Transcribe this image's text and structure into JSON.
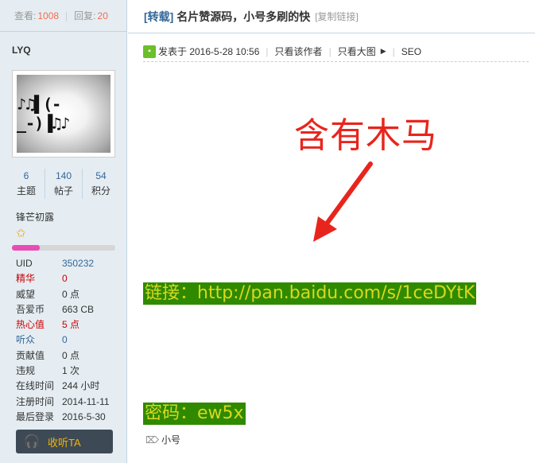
{
  "stats": {
    "views_label": "查看:",
    "views": "1008",
    "replies_label": "回复:",
    "replies": "20"
  },
  "author": {
    "name": "LYQ",
    "avatar_text": "♪♫▌(-_-)▐♫♪",
    "counts": [
      {
        "value": "6",
        "label": "主题"
      },
      {
        "value": "140",
        "label": "帖子"
      },
      {
        "value": "54",
        "label": "积分"
      }
    ],
    "group": "锋芒初露",
    "rank_progress": 0.27,
    "info": [
      {
        "key": "UID",
        "value": "350232",
        "key_color": "#333333",
        "value_color": "#336699"
      },
      {
        "key": "精华",
        "value": "0",
        "key_color": "#cc0000",
        "value_color": "#cc0000"
      },
      {
        "key": "威望",
        "value": "0 点",
        "key_color": "#333333",
        "value_color": "#333333"
      },
      {
        "key": "吾爱币",
        "value": "663 CB",
        "key_color": "#333333",
        "value_color": "#333333"
      },
      {
        "key": "热心值",
        "value": "5 点",
        "key_color": "#cc0000",
        "value_color": "#cc0000"
      },
      {
        "key": "听众",
        "value": "0",
        "key_color": "#336699",
        "value_color": "#336699"
      },
      {
        "key": "贡献值",
        "value": "0 点",
        "key_color": "#333333",
        "value_color": "#333333"
      },
      {
        "key": "违规",
        "value": "1 次",
        "key_color": "#333333",
        "value_color": "#333333"
      },
      {
        "key": "在线时间",
        "value": "244 小时",
        "key_color": "#333333",
        "value_color": "#333333"
      },
      {
        "key": "注册时间",
        "value": "2014-11-11",
        "key_color": "#333333",
        "value_color": "#333333"
      },
      {
        "key": "最后登录",
        "value": "2016-5-30",
        "key_color": "#333333",
        "value_color": "#333333"
      }
    ],
    "follow_label": "收听TA"
  },
  "post": {
    "tag_prefix": "[转载]",
    "title": " 名片赞源码，小号多刷的快",
    "copy_link": "[复制链接]",
    "posted": "发表于 2016-5-28 10:56",
    "only_author": "只看该作者",
    "big_image": "只看大图",
    "seo": "SEO",
    "annotation": "含有木马",
    "link_text": "链接：http://pan.baidu.com/s/1ceDYtK",
    "password_text": "密码：ew5x",
    "tag": "小号"
  },
  "colors": {
    "accent_red": "#e8251d",
    "highlight_bg": "#2f8a00",
    "highlight_text": "#d8d820",
    "stat_number": "#f26c4f"
  }
}
